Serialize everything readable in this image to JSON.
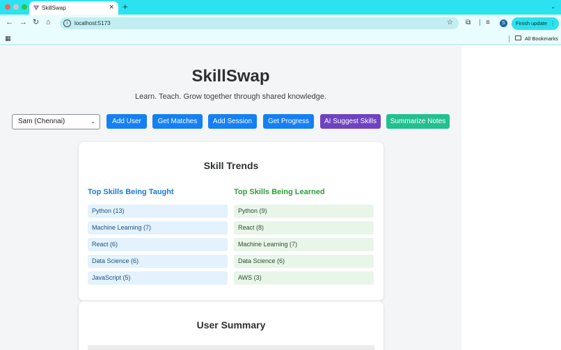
{
  "browser": {
    "tab_title": "SkillSwap",
    "url": "localhost:5173",
    "profile_initial": "S",
    "update_button": "Finish update",
    "bookmarks_label": "All Bookmarks"
  },
  "app": {
    "title": "SkillSwap",
    "tagline": "Learn. Teach. Grow together through shared knowledge.",
    "selected_user": "Sam (Chennai)",
    "buttons": {
      "add_user": "Add User",
      "get_matches": "Get Matches",
      "add_session": "Add Session",
      "get_progress": "Get Progress",
      "ai_suggest": "AI Suggest Skills",
      "summarize": "Summarize Notes"
    },
    "colors": {
      "primary": "#1580f3",
      "ai": "#6f42c1",
      "summarize": "#22c08f"
    }
  },
  "trends": {
    "title": "Skill Trends",
    "taught_heading": "Top Skills Being Taught",
    "learned_heading": "Top Skills Being Learned",
    "taught": [
      "Python (13)",
      "Machine Learning (7)",
      "React (6)",
      "Data Science (6)",
      "JavaScript (5)"
    ],
    "learned": [
      "Python (9)",
      "React (8)",
      "Machine Learning (7)",
      "Data Science (6)",
      "AWS (3)"
    ]
  },
  "summary": {
    "title": "User Summary"
  }
}
